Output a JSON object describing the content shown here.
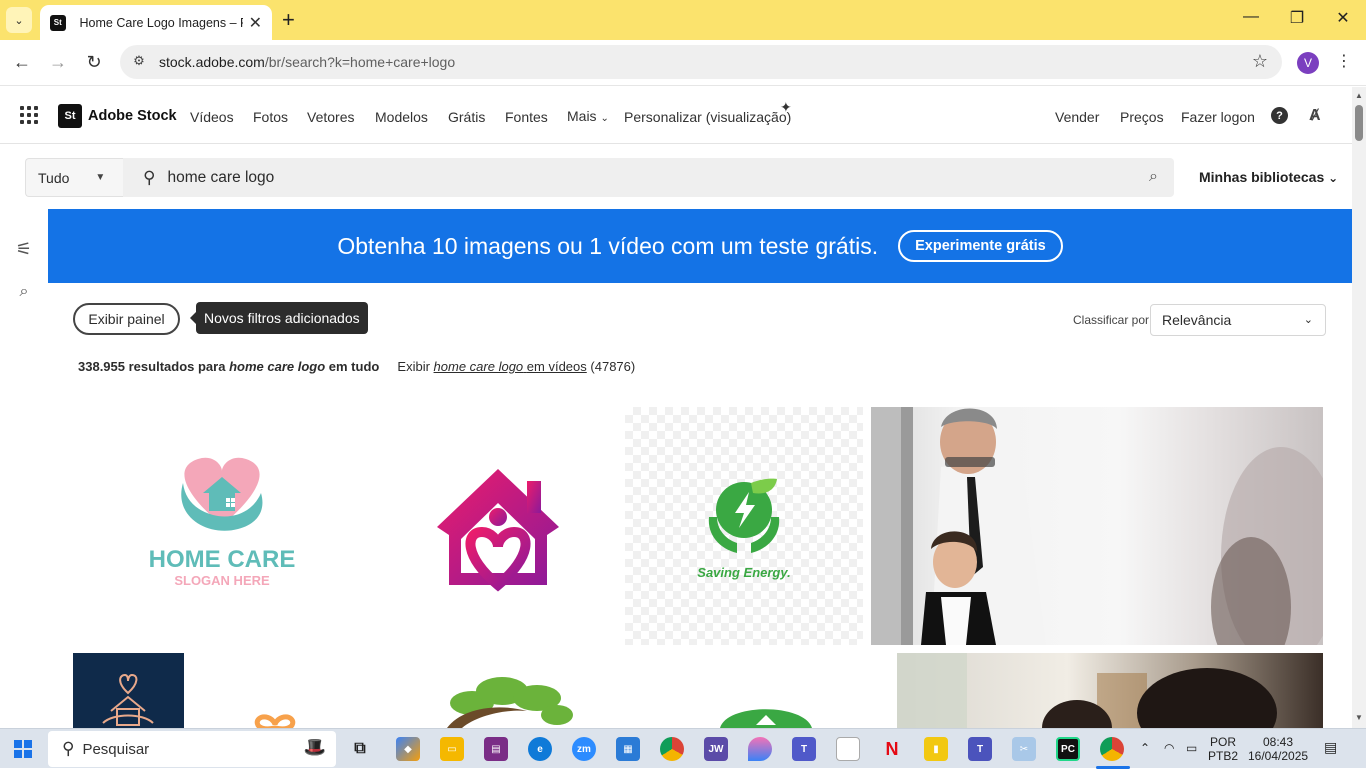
{
  "browser": {
    "tab_title": "Home Care Logo Imagens – Procurar",
    "favicon_text": "St",
    "url_host": "stock.adobe.com",
    "url_path": "/br/search?k=home+care+logo",
    "profile_initial": "V"
  },
  "header": {
    "brand_badge": "St",
    "brand": "Adobe Stock",
    "nav": [
      "Vídeos",
      "Fotos",
      "Vetores",
      "Modelos",
      "Grátis",
      "Fontes",
      "Mais",
      "Personalizar (visualização)"
    ],
    "right": [
      "Vender",
      "Preços",
      "Fazer logon"
    ],
    "help": "?"
  },
  "search": {
    "scope": "Tudo",
    "query": "home care logo",
    "libraries": "Minhas bibliotecas"
  },
  "banner": {
    "text": "Obtenha 10 imagens ou 1 vídeo com um teste grátis.",
    "button": "Experimente grátis",
    "color": "#1473e6"
  },
  "filters": {
    "show_panel": "Exibir painel",
    "tooltip": "Novos filtros adicionados",
    "sort_label": "Classificar por",
    "sort_value": "Relevância"
  },
  "results": {
    "count": "338.955",
    "mid1": "resultados para",
    "query": "home care logo",
    "mid2": "em tudo",
    "show": "Exibir",
    "video_query": "home care logo",
    "video_link": "em vídeos",
    "video_count": "(47876)"
  },
  "tiles": {
    "t1_title": "HOME CARE",
    "t1_slogan": "SLOGAN HERE",
    "t3_caption": "Saving Energy."
  },
  "taskbar": {
    "search_placeholder": "Pesquisar",
    "lang1": "POR",
    "lang2": "PTB2",
    "time": "08:43",
    "date": "16/04/2025"
  }
}
